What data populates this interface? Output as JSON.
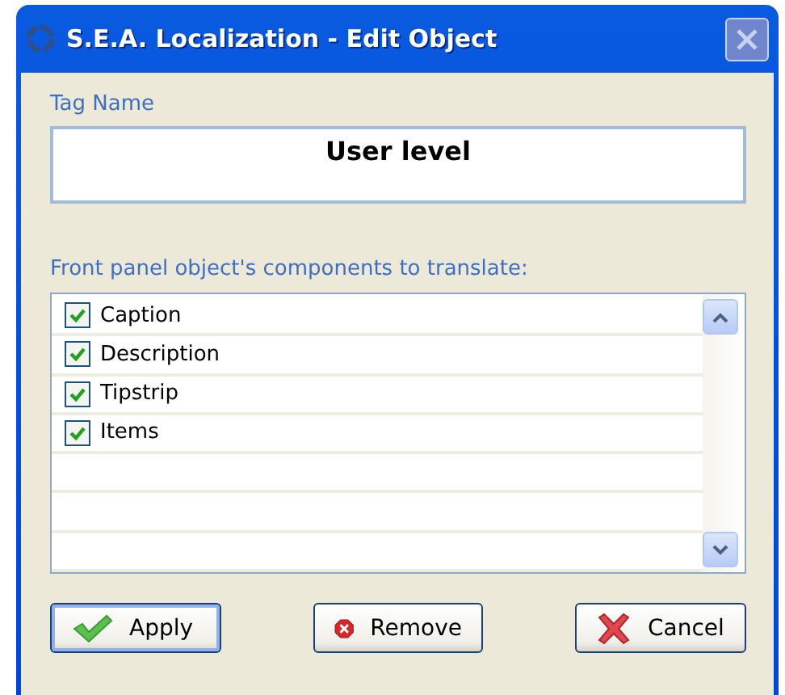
{
  "window": {
    "title": "S.E.A. Localization - Edit Object",
    "close_disabled": true
  },
  "tag_name": {
    "label": "Tag Name",
    "value": "User level"
  },
  "components": {
    "label": "Front panel object's components to translate:",
    "items": [
      {
        "label": "Caption",
        "checked": true
      },
      {
        "label": "Description",
        "checked": true
      },
      {
        "label": "Tipstrip",
        "checked": true
      },
      {
        "label": "Items",
        "checked": true
      }
    ]
  },
  "buttons": [
    {
      "label": "Apply",
      "kind": "apply",
      "default": true
    },
    {
      "label": "Remove",
      "kind": "remove",
      "default": false
    },
    {
      "label": "Cancel",
      "kind": "cancel",
      "default": false
    }
  ]
}
